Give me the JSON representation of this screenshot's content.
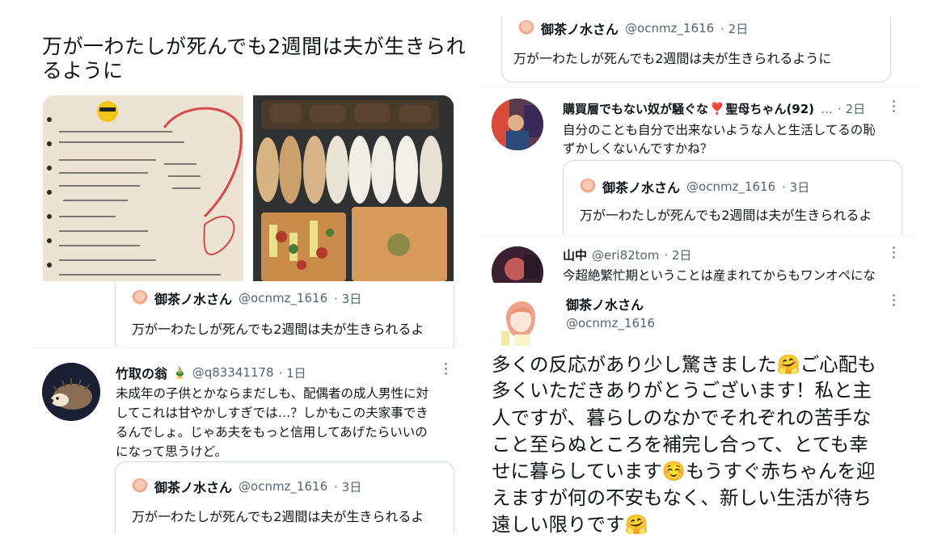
{
  "left_top": {
    "tweet_text_line1": "万が一わたしが死んでも2週間は夫が生きられ",
    "tweet_text_line2": "るように",
    "note_image_alt": "handwritten-meal-note",
    "food_image_alt": "prepared-onigiri-and-toast"
  },
  "quote_common": {
    "name": "御茶ノ水さん",
    "handle": "@ocnmz_1616",
    "text": "万が一わたしが死んでも2週間は夫が生きられるよ",
    "text_full": "万が一わたしが死んでも2週間は夫が生きられるように"
  },
  "quote_left_1": {
    "time": "· 3日"
  },
  "reply_bamboo": {
    "name": "竹取の翁",
    "name_emoji": "🎍",
    "handle": "@q83341178",
    "time": "· 1日",
    "line1": "未成年の子供とかならまだしも、配偶者の成人男性に対",
    "line2": "してこれは甘やかしすぎでは…？しかもこの夫家事でき",
    "line3": "るんでしょ。じゃあ夫をもっと信用してあげたらいいの",
    "line4": "になって思うけど。"
  },
  "quote_left_2": {
    "time": "· 3日"
  },
  "quote_right_top": {
    "time": "· 2日"
  },
  "reply_kobai": {
    "name": "購買層でもない奴が騒ぐな",
    "name_emoji": "❣️",
    "name_suffix": "聖母ちゃん(92)",
    "ellipsis": "…",
    "time": "· 2日",
    "line1": "自分のことも自分で出来ないような人と生活してるの恥",
    "line2": "ずかしくないんですかね？"
  },
  "quote_right_mid": {
    "time": "· 3日"
  },
  "reply_yamanaka": {
    "name": "山中",
    "handle": "@eri82tom",
    "time": "· 2日",
    "line1": "今超絶繁忙期ということは産まれてからもワンオペにな"
  },
  "main_tweet": {
    "name": "御茶ノ水さん",
    "handle": "@ocnmz_1616",
    "line1": "多くの反応があり少し驚きました🤗ご心配も",
    "line2": "多くいただきありがとうございます！私と主",
    "line3": "人ですが、暮らしのなかでそれぞれの苦手な",
    "line4": "こと至らぬところを補完し合って、とても幸",
    "line5": "せに暮らしています☺️もうすぐ赤ちゃんを迎",
    "line6": "えますが何の不安もなく、新しい生活が待ち",
    "line7": "遠しい限りです🤗"
  }
}
